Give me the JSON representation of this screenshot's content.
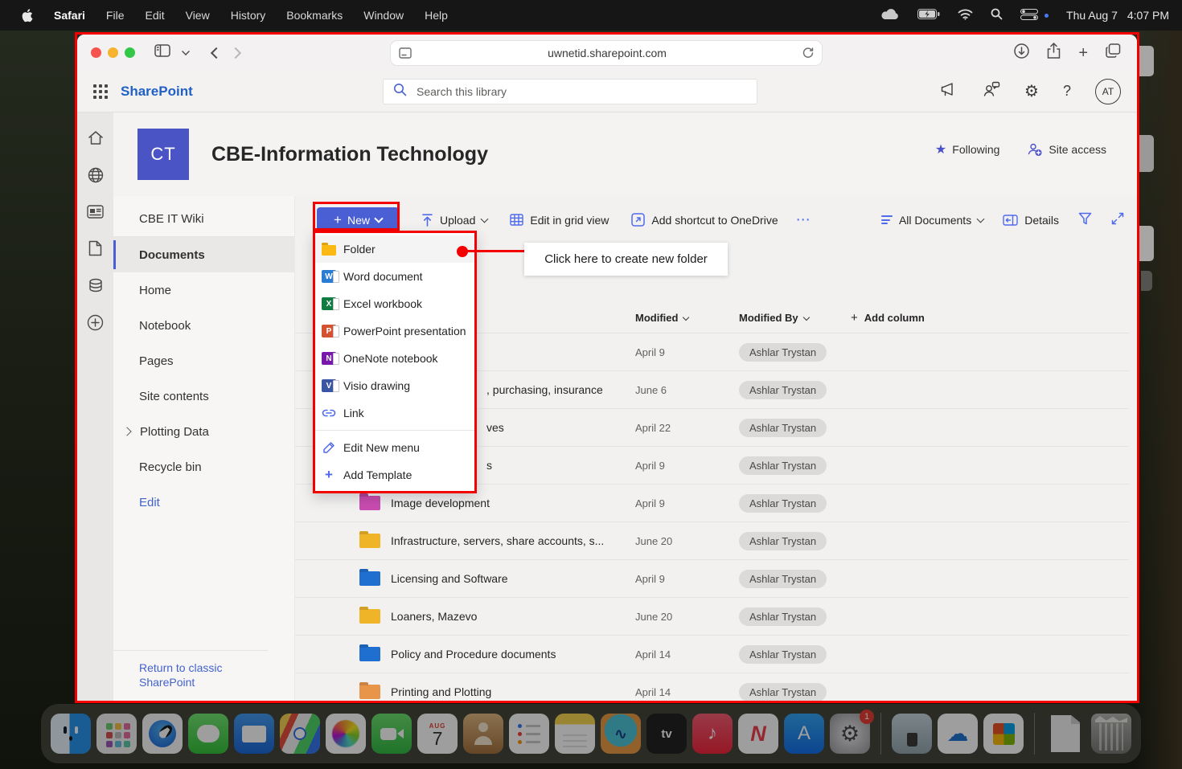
{
  "colors": {
    "annotation_red": "#f40000",
    "accent": "#4f6bed",
    "brand_blue": "#2160c4",
    "logo_bg": "#4a54c4",
    "new_button": "#4a5fd4",
    "link_blue": "#4262cc"
  },
  "icons": {
    "plus": "+",
    "ellipsis": "⋯",
    "question": "?",
    "gear": "⚙",
    "star": "★"
  },
  "menubar": {
    "apps": [
      "Safari",
      "File",
      "Edit",
      "View",
      "History",
      "Bookmarks",
      "Window",
      "Help"
    ],
    "status": {
      "date": "Thu Aug 7",
      "time": "4:07 PM"
    }
  },
  "browser": {
    "url": "uwnetid.sharepoint.com"
  },
  "suite": {
    "brand": "SharePoint",
    "search_placeholder": "Search this library",
    "avatar": "AT"
  },
  "site": {
    "logo": "CT",
    "title": "CBE-Information Technology",
    "following": "Following",
    "access": "Site access"
  },
  "nav": {
    "items": [
      {
        "label": "CBE IT Wiki",
        "divider": true
      },
      {
        "label": "Documents",
        "selected": true
      },
      {
        "label": "Home"
      },
      {
        "label": "Notebook"
      },
      {
        "label": "Pages"
      },
      {
        "label": "Site contents"
      },
      {
        "label": "Plotting Data",
        "chevron": true
      },
      {
        "label": "Recycle bin"
      }
    ],
    "edit_label": "Edit",
    "classic_label": "Return to classic SharePoint"
  },
  "commandbar": {
    "new": "New",
    "upload": "Upload",
    "grid": "Edit in grid view",
    "shortcut": "Add shortcut to OneDrive",
    "view": "All Documents",
    "details": "Details"
  },
  "menu": {
    "items": [
      {
        "label": "Folder",
        "type": "folder",
        "color": "#fdb913",
        "highlighted": true
      },
      {
        "label": "Word document",
        "type": "app",
        "letter": "W",
        "color": "#2b7cd3"
      },
      {
        "label": "Excel workbook",
        "type": "app",
        "letter": "X",
        "color": "#107c41"
      },
      {
        "label": "PowerPoint presentation",
        "type": "app",
        "letter": "P",
        "color": "#d35230"
      },
      {
        "label": "OneNote notebook",
        "type": "app",
        "letter": "N",
        "color": "#7719aa"
      },
      {
        "label": "Visio drawing",
        "type": "app",
        "letter": "V",
        "color": "#3955a3"
      },
      {
        "label": "Link",
        "type": "link"
      }
    ],
    "actions": [
      {
        "label": "Edit New menu",
        "type": "pencil"
      },
      {
        "label": "Add Template",
        "type": "plus"
      }
    ]
  },
  "annotation": {
    "callout": "Click here to create new folder"
  },
  "table": {
    "headers": {
      "modified": "Modified",
      "modified_by": "Modified By",
      "add_column": "Add column"
    },
    "rows": [
      {
        "name": "",
        "obscured": true,
        "modified": "April 9",
        "by": "Ashlar Trystan"
      },
      {
        "name": ", purchasing, insurance",
        "obscured": true,
        "modified": "June 6",
        "by": "Ashlar Trystan"
      },
      {
        "name": "ves",
        "obscured": true,
        "modified": "April 22",
        "by": "Ashlar Trystan"
      },
      {
        "name": "s",
        "obscured": true,
        "modified": "April 9",
        "by": "Ashlar Trystan"
      },
      {
        "name": "Image development",
        "folder_color": "#c94cb0",
        "modified": "April 9",
        "by": "Ashlar Trystan"
      },
      {
        "name": "Infrastructure, servers, share accounts, s...",
        "folder_color": "#f0b429",
        "modified": "June 20",
        "by": "Ashlar Trystan"
      },
      {
        "name": "Licensing and Software",
        "folder_color": "#1f6fd0",
        "modified": "April 9",
        "by": "Ashlar Trystan"
      },
      {
        "name": "Loaners, Mazevo",
        "folder_color": "#f0b429",
        "modified": "June 20",
        "by": "Ashlar Trystan"
      },
      {
        "name": "Policy and Procedure documents",
        "folder_color": "#1f6fd0",
        "modified": "April 14",
        "by": "Ashlar Trystan"
      },
      {
        "name": "Printing and Plotting",
        "folder_color": "#e8954a",
        "modified": "April 14",
        "by": "Ashlar Trystan"
      }
    ]
  },
  "dock": {
    "items": [
      {
        "id": "finder",
        "label": "Finder",
        "running": true
      },
      {
        "id": "launchpad",
        "label": "Launchpad"
      },
      {
        "id": "safari",
        "label": "Safari",
        "running": true
      },
      {
        "id": "messages",
        "label": "Messages"
      },
      {
        "id": "mail",
        "label": "Mail"
      },
      {
        "id": "maps",
        "label": "Maps"
      },
      {
        "id": "photos",
        "label": "Photos"
      },
      {
        "id": "facetime",
        "label": "FaceTime"
      },
      {
        "id": "calendar",
        "label": "Calendar",
        "top": "AUG",
        "day": "7"
      },
      {
        "id": "contacts",
        "label": "Contacts"
      },
      {
        "id": "reminders",
        "label": "Reminders"
      },
      {
        "id": "notes",
        "label": "Notes"
      },
      {
        "id": "waveapp",
        "label": "Media App",
        "glyph": "∿"
      },
      {
        "id": "appletv",
        "label": "Apple TV",
        "glyph": "tv"
      },
      {
        "id": "music",
        "label": "Music",
        "glyph": "♪"
      },
      {
        "id": "news",
        "label": "News",
        "glyph": "N"
      },
      {
        "id": "appstore",
        "label": "App Store",
        "glyph": "A"
      },
      {
        "id": "settings",
        "label": "System Settings",
        "glyph": "⚙",
        "badge": "1"
      },
      {
        "id": "sep"
      },
      {
        "id": "downloads",
        "label": "Downloads"
      },
      {
        "id": "onedrive",
        "label": "OneDrive",
        "glyph": "☁"
      },
      {
        "id": "msoffice",
        "label": "Microsoft 365"
      },
      {
        "id": "sep"
      },
      {
        "id": "document",
        "label": "Document"
      },
      {
        "id": "trash",
        "label": "Trash"
      }
    ]
  }
}
